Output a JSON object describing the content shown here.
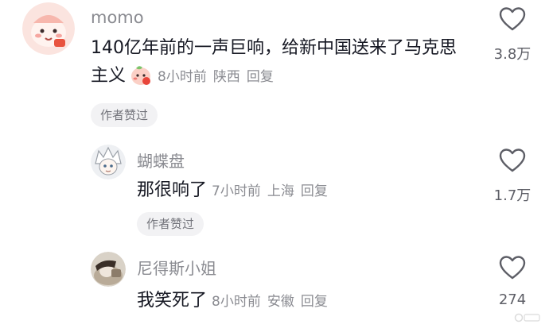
{
  "comments": [
    {
      "username": "momo",
      "text": "140亿年前的一声巨响，给新中国送来了马克思主义",
      "emoji": "peach-blush-emoji",
      "time": "8小时前",
      "location": "陕西",
      "reply_label": "回复",
      "badge": "作者赞过",
      "likes": "3.8万"
    },
    {
      "username": "蝴蝶盘",
      "text": "那很响了",
      "time": "7小时前",
      "location": "上海",
      "reply_label": "回复",
      "badge": "作者赞过",
      "likes": "1.7万"
    },
    {
      "username": "尼得斯小姐",
      "text": "我笑死了",
      "time": "8小时前",
      "location": "安徽",
      "reply_label": "回复",
      "likes": "274"
    }
  ],
  "colors": {
    "text": "#161823",
    "meta": "#8a8b91",
    "badge_bg": "#f2f2f4"
  }
}
